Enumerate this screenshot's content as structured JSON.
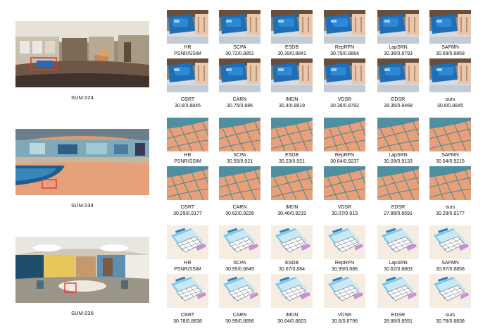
{
  "groups": [
    {
      "label": "SUM.024",
      "scene": "office",
      "row1": [
        {
          "method": "HR",
          "score": "PSNR/SSIM"
        },
        {
          "method": "SCPA",
          "score": "30.72/0.8851"
        },
        {
          "method": "ESDB",
          "score": "30.39/0.8841"
        },
        {
          "method": "RepRFN",
          "score": "30.79/0.8864"
        },
        {
          "method": "LapSRN",
          "score": "30.36/0.8793"
        },
        {
          "method": "SAFMN",
          "score": "30.69/0.8858"
        }
      ],
      "row2": [
        {
          "method": "OSRT",
          "score": "30.6/0.8845"
        },
        {
          "method": "CARN",
          "score": "30.75/0.886"
        },
        {
          "method": "IMDN",
          "score": "30.4/0.8819"
        },
        {
          "method": "VDSR",
          "score": "30.36/0.8792"
        },
        {
          "method": "EDSR",
          "score": "28.36/0.8468"
        },
        {
          "method": "ours",
          "score": "30.6/0.8845"
        }
      ]
    },
    {
      "label": "SUM.034",
      "scene": "pool",
      "row1": [
        {
          "method": "HR",
          "score": "PSNR/SSIM"
        },
        {
          "method": "SCPA",
          "score": "30.55/0.921"
        },
        {
          "method": "ESDB",
          "score": "30.23/0.921"
        },
        {
          "method": "RepRFN",
          "score": "30.64/0.9237"
        },
        {
          "method": "LapSRN",
          "score": "30.09/0.9133"
        },
        {
          "method": "SAFMN",
          "score": "30.54/0.9215"
        }
      ],
      "row2": [
        {
          "method": "OSRT",
          "score": "30.29/0.9177"
        },
        {
          "method": "CARN",
          "score": "30.62/0.9226"
        },
        {
          "method": "IMDN",
          "score": "30.46/0.9219"
        },
        {
          "method": "VDSR",
          "score": "30.07/0.913"
        },
        {
          "method": "EDSR",
          "score": "27.88/0.8591"
        },
        {
          "method": "ours",
          "score": "30.29/0.9177"
        }
      ]
    },
    {
      "label": "SUM.036",
      "scene": "lounge",
      "row1": [
        {
          "method": "HR",
          "score": "PSNR/SSIM"
        },
        {
          "method": "SCPA",
          "score": "30.95/0.8849"
        },
        {
          "method": "ESDB",
          "score": "30.67/0.884"
        },
        {
          "method": "RepRFN",
          "score": "30.99/0.886"
        },
        {
          "method": "LapSRN",
          "score": "30.62/0.8803"
        },
        {
          "method": "SAFMN",
          "score": "30.97/0.8858"
        }
      ],
      "row2": [
        {
          "method": "OSRT",
          "score": "30.78/0.8838"
        },
        {
          "method": "CARN",
          "score": "30.99/0.8856"
        },
        {
          "method": "IMDN",
          "score": "30.64/0.8823"
        },
        {
          "method": "VDSR",
          "score": "30.6/0.8796"
        },
        {
          "method": "EDSR",
          "score": "28.86/0.8551"
        },
        {
          "method": "ours",
          "score": "30.78/0.8838"
        }
      ]
    }
  ],
  "colors": {
    "highlight_box": "#e0312a",
    "pool_floor": "#e9a07a",
    "pool_grout": "#3f8a8e",
    "water_blue": "#1e6fb8",
    "paper_bg": "#f6ede2"
  }
}
